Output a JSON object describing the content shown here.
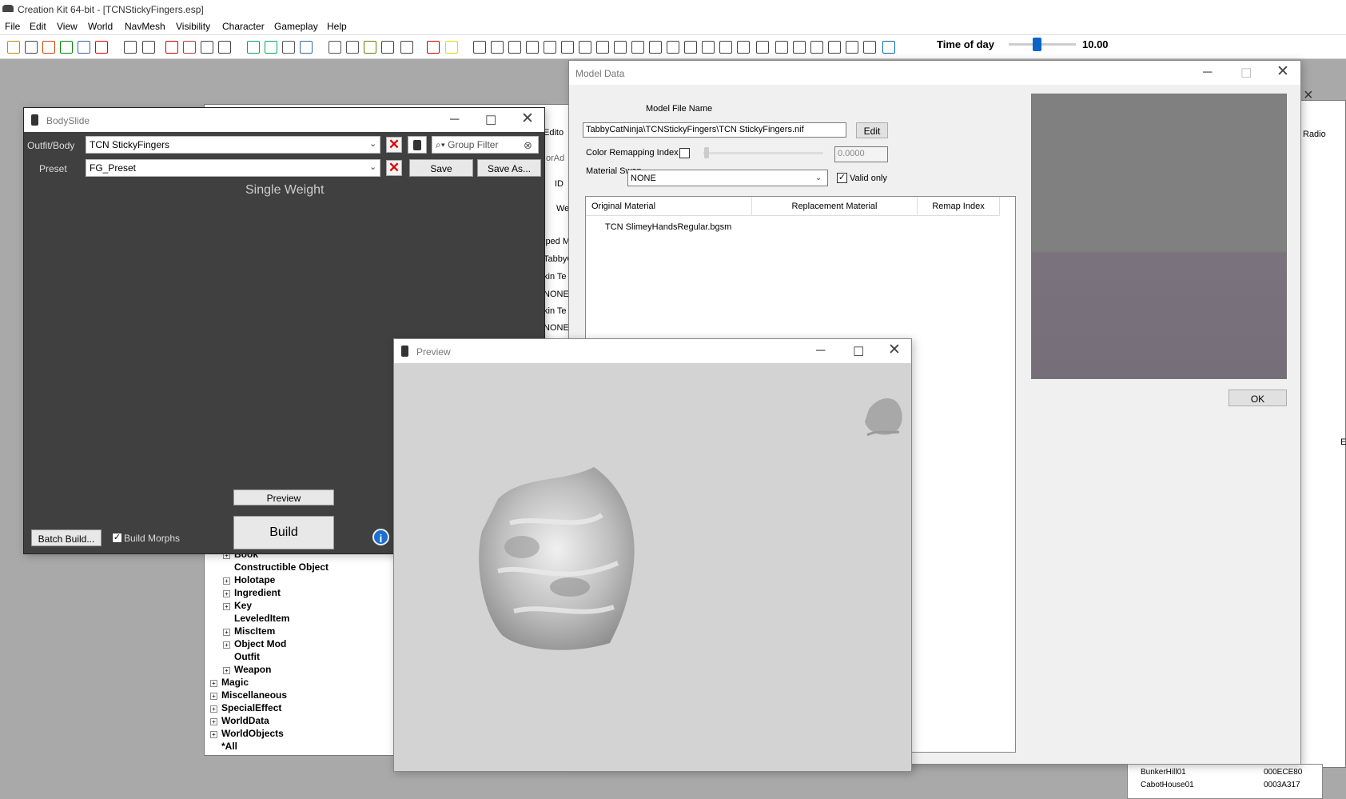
{
  "app": {
    "title": "Creation Kit 64-bit - [TCNStickyFingers.esp]"
  },
  "menu": [
    "File",
    "Edit",
    "View",
    "World",
    "NavMesh",
    "Visibility",
    "Character",
    "Gameplay",
    "Help"
  ],
  "toolbar": {
    "time_label": "Time of day",
    "time_value": "10.00",
    "time_fraction": 0.42
  },
  "model_window": {
    "title": "Model Data",
    "file_name_label": "Model File Name",
    "file_name_value": "TabbyCatNinja\\TCNStickyFingers\\TCN StickyFingers.nif",
    "edit_label": "Edit",
    "color_remap_label": "Color Remapping Index",
    "color_remap_value": "0.0000",
    "material_swap_label": "Material Swap",
    "material_swap_value": "NONE",
    "valid_only_label": "Valid only",
    "ok_label": "OK",
    "table": {
      "headers": [
        "Original Material",
        "Replacement Material",
        "Remap Index"
      ],
      "rows": [
        [
          "TCN SlimeyHandsRegular.bgsm",
          "",
          ""
        ]
      ]
    }
  },
  "object_window": {
    "peek": [
      "Edito",
      "orAd",
      "ID",
      "We",
      "iped M",
      "TabbyC",
      "kin Te",
      "NONE",
      "kin Te",
      "NONE"
    ],
    "tree": [
      {
        "label": "Book",
        "indent": 1,
        "plus": true
      },
      {
        "label": "Constructible Object",
        "indent": 1,
        "plus": false
      },
      {
        "label": "Holotape",
        "indent": 1,
        "plus": true
      },
      {
        "label": "Ingredient",
        "indent": 1,
        "plus": true
      },
      {
        "label": "Key",
        "indent": 1,
        "plus": true
      },
      {
        "label": "LeveledItem",
        "indent": 1,
        "plus": false
      },
      {
        "label": "MiscItem",
        "indent": 1,
        "plus": true
      },
      {
        "label": "Object Mod",
        "indent": 1,
        "plus": true
      },
      {
        "label": "Outfit",
        "indent": 1,
        "plus": false
      },
      {
        "label": "Weapon",
        "indent": 1,
        "plus": true
      },
      {
        "label": "Magic",
        "indent": 0,
        "plus": true
      },
      {
        "label": "Miscellaneous",
        "indent": 0,
        "plus": true
      },
      {
        "label": "SpecialEffect",
        "indent": 0,
        "plus": true
      },
      {
        "label": "WorldData",
        "indent": 0,
        "plus": true
      },
      {
        "label": "WorldObjects",
        "indent": 0,
        "plus": true
      },
      {
        "label": "*All",
        "indent": 0,
        "plus": false
      }
    ]
  },
  "right_window": {
    "radio_label": "Radio",
    "e_label": "E",
    "rows": [
      {
        "name": "BunkerHill01",
        "id": "000ECE80"
      },
      {
        "name": "CabotHouse01",
        "id": "0003A317"
      }
    ]
  },
  "bodyslide": {
    "title": "BodySlide",
    "outfit_label": "Outfit/Body",
    "outfit_value": "TCN StickyFingers",
    "preset_label": "Preset",
    "preset_value": "FG_Preset",
    "group_filter_placeholder": "Group Filter",
    "save_label": "Save",
    "save_as_label": "Save As...",
    "single_weight_label": "Single Weight",
    "preview_label": "Preview",
    "build_label": "Build",
    "batch_build_label": "Batch Build...",
    "build_morphs_label": "Build Morphs"
  },
  "preview_window": {
    "title": "Preview"
  }
}
